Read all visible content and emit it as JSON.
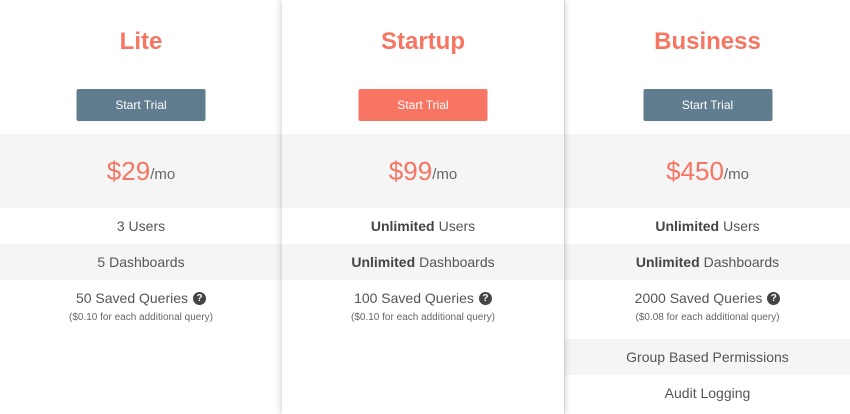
{
  "plans": [
    {
      "name": "Lite",
      "button_label": "Start Trial",
      "price": "$29",
      "period": "/mo",
      "users": {
        "bold": "",
        "text": "3 Users"
      },
      "dashboards": {
        "bold": "",
        "text": "5 Dashboards"
      },
      "queries": "50 Saved Queries",
      "queries_note": "($0.10 for each additional query)"
    },
    {
      "name": "Startup",
      "button_label": "Start Trial",
      "price": "$99",
      "period": "/mo",
      "users": {
        "bold": "Unlimited",
        "text": "Users"
      },
      "dashboards": {
        "bold": "Unlimited",
        "text": "Dashboards"
      },
      "queries": "100 Saved Queries",
      "queries_note": "($0.10 for each additional query)"
    },
    {
      "name": "Business",
      "button_label": "Start Trial",
      "price": "$450",
      "period": "/mo",
      "users": {
        "bold": "Unlimited",
        "text": "Users"
      },
      "dashboards": {
        "bold": "Unlimited",
        "text": "Dashboards"
      },
      "queries": "2000 Saved Queries",
      "queries_note": "($0.08 for each additional query)",
      "extra_features": [
        "Group Based Permissions",
        "Audit Logging"
      ]
    }
  ],
  "icons": {
    "help": "question-circle-icon",
    "help_glyph": "?"
  },
  "colors": {
    "accent": "#f47663",
    "accent_button": "#f87563",
    "neutral_button": "#5f7d8f",
    "band": "#f5f5f5"
  }
}
